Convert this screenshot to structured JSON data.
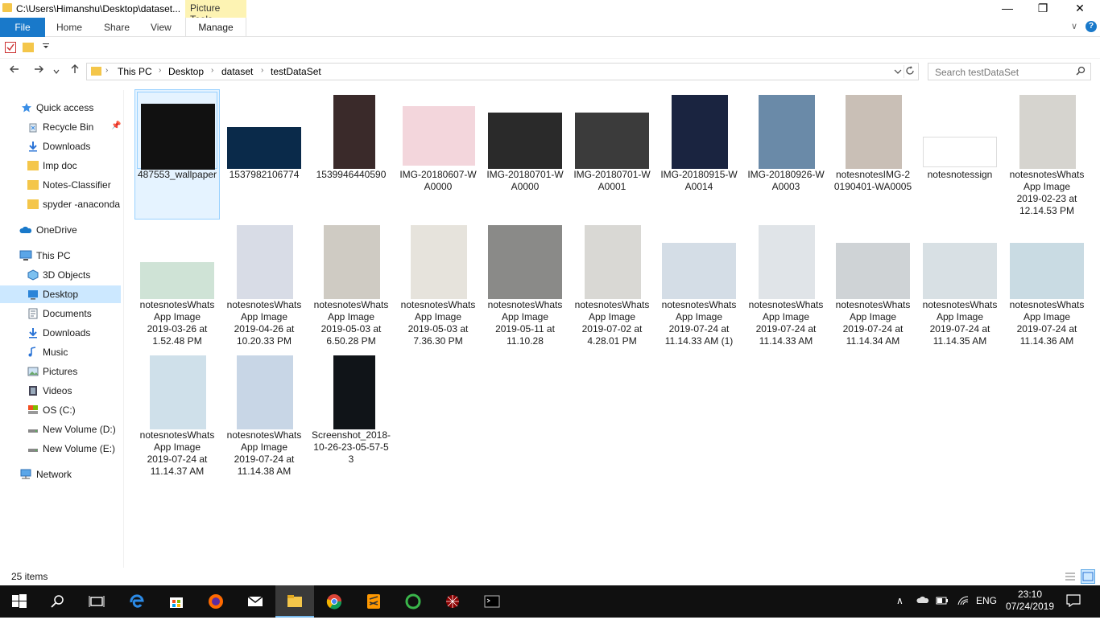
{
  "window": {
    "title": "C:\\Users\\Himanshu\\Desktop\\dataset...",
    "context_tab": "Picture Tools",
    "minimize": "—",
    "maximize": "❐",
    "close": "✕"
  },
  "ribbon": {
    "file": "File",
    "tabs": [
      "Home",
      "Share",
      "View"
    ],
    "manage": "Manage",
    "collapse": "∨",
    "help": "?"
  },
  "address": {
    "breadcrumbs": [
      "This PC",
      "Desktop",
      "dataset",
      "testDataSet"
    ],
    "search_placeholder": "Search testDataSet"
  },
  "sidebar": {
    "items": [
      {
        "label": "Quick access",
        "icon": "star-icon"
      },
      {
        "label": "Recycle Bin",
        "icon": "recycle-bin-icon"
      },
      {
        "label": "Downloads",
        "icon": "download-icon"
      },
      {
        "label": "Imp doc",
        "icon": "folder-icon"
      },
      {
        "label": "Notes-Classifier",
        "icon": "folder-icon"
      },
      {
        "label": "spyder -anaconda",
        "icon": "folder-icon"
      },
      {
        "label": "OneDrive",
        "icon": "cloud-icon"
      },
      {
        "label": "This PC",
        "icon": "computer-icon"
      },
      {
        "label": "3D Objects",
        "icon": "cube-icon"
      },
      {
        "label": "Desktop",
        "icon": "desktop-icon"
      },
      {
        "label": "Documents",
        "icon": "document-icon"
      },
      {
        "label": "Downloads",
        "icon": "download-icon"
      },
      {
        "label": "Music",
        "icon": "music-icon"
      },
      {
        "label": "Pictures",
        "icon": "pictures-icon"
      },
      {
        "label": "Videos",
        "icon": "video-icon"
      },
      {
        "label": "OS (C:)",
        "icon": "drive-icon"
      },
      {
        "label": "New Volume (D:)",
        "icon": "drive-icon"
      },
      {
        "label": "New Volume (E:)",
        "icon": "drive-icon"
      },
      {
        "label": "Network",
        "icon": "network-icon"
      }
    ]
  },
  "files": [
    {
      "name": "487553_wallpaper"
    },
    {
      "name": "1537982106774"
    },
    {
      "name": "1539946440590"
    },
    {
      "name": "IMG-20180607-WA0000"
    },
    {
      "name": "IMG-20180701-WA0000"
    },
    {
      "name": "IMG-20180701-WA0001"
    },
    {
      "name": "IMG-20180915-WA0014"
    },
    {
      "name": "IMG-20180926-WA0003"
    },
    {
      "name": "notesnotesIMG-20190401-WA0005"
    },
    {
      "name": "notesnotessign"
    },
    {
      "name": "notesnotesWhatsApp Image 2019-02-23 at 12.14.53 PM"
    },
    {
      "name": "notesnotesWhatsApp Image 2019-03-26 at 1.52.48 PM"
    },
    {
      "name": "notesnotesWhatsApp Image 2019-04-26 at 10.20.33 PM"
    },
    {
      "name": "notesnotesWhatsApp Image 2019-05-03 at 6.50.28 PM"
    },
    {
      "name": "notesnotesWhatsApp Image 2019-05-03 at 7.36.30 PM"
    },
    {
      "name": "notesnotesWhatsApp Image 2019-05-11 at 11.10.28"
    },
    {
      "name": "notesnotesWhatsApp Image 2019-07-02 at 4.28.01 PM"
    },
    {
      "name": "notesnotesWhatsApp Image 2019-07-24 at 11.14.33 AM (1)"
    },
    {
      "name": "notesnotesWhatsApp Image 2019-07-24 at 11.14.33 AM"
    },
    {
      "name": "notesnotesWhatsApp Image 2019-07-24 at 11.14.34 AM"
    },
    {
      "name": "notesnotesWhatsApp Image 2019-07-24 at 11.14.35 AM"
    },
    {
      "name": "notesnotesWhatsApp Image 2019-07-24 at 11.14.36 AM"
    },
    {
      "name": "notesnotesWhatsApp Image 2019-07-24 at 11.14.37 AM"
    },
    {
      "name": "notesnotesWhatsApp Image 2019-07-24 at 11.14.38 AM"
    },
    {
      "name": "Screenshot_2018-10-26-23-05-57-53"
    }
  ],
  "labels": [
    "487553_wallpaper",
    "1537982106774",
    "1539946440590",
    "IMG-20180607-W\nA0000",
    "IMG-20180701-W\nA0000",
    "IMG-20180701-W\nA0001",
    "IMG-20180915-W\nA0014",
    "IMG-20180926-W\nA0003",
    "notesnotesIMG-2\n0190401-WA0005",
    "notesnotessign",
    "notesnotesWhats\nApp Image\n2019-02-23 at\n12.14.53 PM",
    "notesnotesWhats\nApp Image\n2019-03-26 at\n1.52.48 PM",
    "notesnotesWhats\nApp Image\n2019-04-26 at\n10.20.33 PM",
    "notesnotesWhats\nApp Image\n2019-05-03 at\n6.50.28 PM",
    "notesnotesWhats\nApp Image\n2019-05-03 at\n7.36.30 PM",
    "notesnotesWhats\nApp Image\n2019-05-11 at\n11.10.28",
    "notesnotesWhats\nApp Image\n2019-07-02 at\n4.28.01 PM",
    "notesnotesWhats\nApp Image\n2019-07-24 at\n11.14.33 AM (1)",
    "notesnotesWhats\nApp Image\n2019-07-24 at\n11.14.33 AM",
    "notesnotesWhats\nApp Image\n2019-07-24 at\n11.14.34 AM",
    "notesnotesWhats\nApp Image\n2019-07-24 at\n11.14.35 AM",
    "notesnotesWhats\nApp Image\n2019-07-24 at\n11.14.36 AM",
    "notesnotesWhats\nApp Image\n2019-07-24 at\n11.14.37 AM",
    "notesnotesWhats\nApp Image\n2019-07-24 at\n11.14.38 AM",
    "Screenshot_2018-\n10-26-23-05-57-5\n3"
  ],
  "thumb_colors": [
    "#111111",
    "#0a2a4a",
    "#3a2a2a",
    "#f3d6dc",
    "#2a2a2a",
    "#3b3b3b",
    "#1a2440",
    "#6a8aa8",
    "#c9bfb6",
    "#ffffff",
    "#d6d4cf",
    "#cfe3d6",
    "#d8dce6",
    "#cfcbc3",
    "#e6e3dc",
    "#8a8a88",
    "#d9d8d4",
    "#d4dde6",
    "#e0e4e8",
    "#cfd3d6",
    "#d8e0e4",
    "#c9dbe3",
    "#cfe0ea",
    "#c8d6e6",
    "#101418"
  ],
  "status": {
    "item_count": "25 items"
  },
  "tray": {
    "language": "ENG",
    "time": "23:10",
    "date": "07/24/2019",
    "chevron": "∧"
  }
}
